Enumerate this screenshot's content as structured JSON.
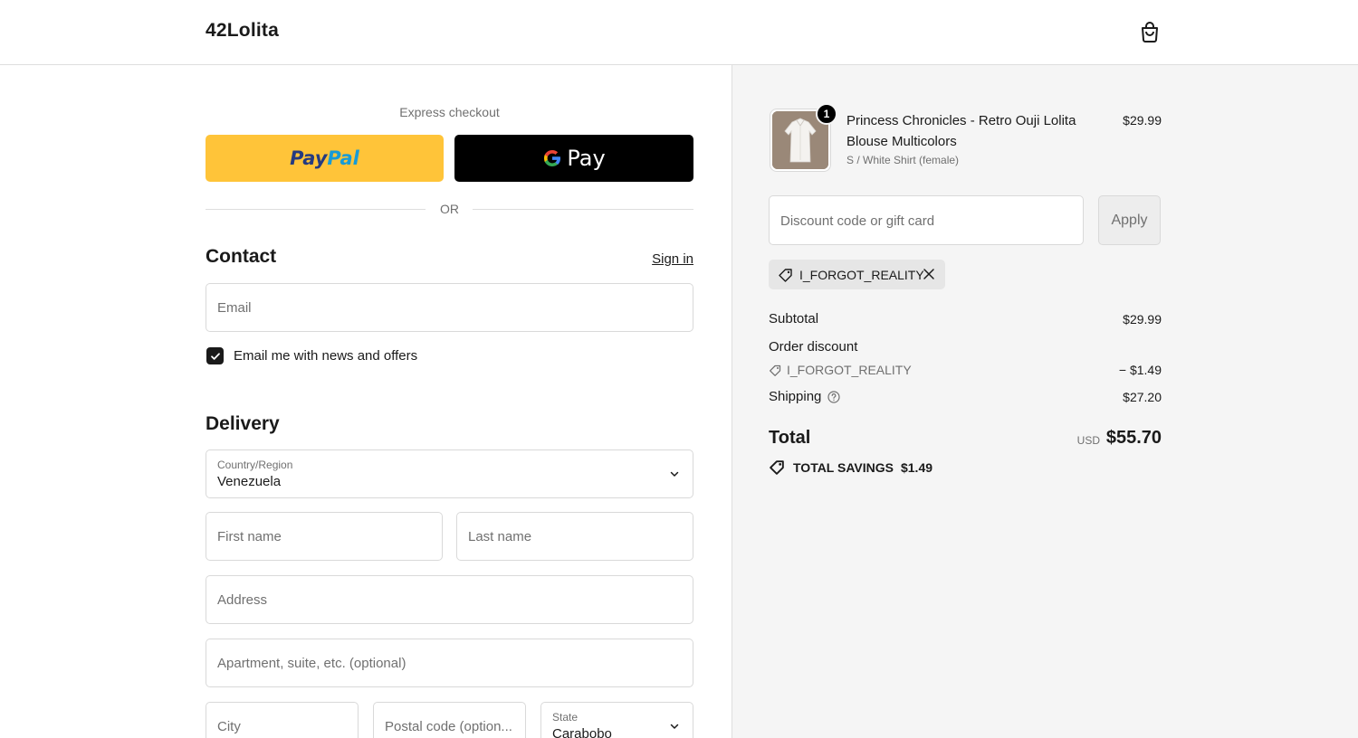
{
  "header": {
    "brand": "42Lolita",
    "icons": {
      "cart": "shopping-bag-icon"
    }
  },
  "express": {
    "label": "Express checkout",
    "paypal_a": "Pay",
    "paypal_b": "Pal",
    "gpay_label": "Pay",
    "or": "OR"
  },
  "contact": {
    "title": "Contact",
    "signin": "Sign in",
    "email_placeholder": "Email",
    "news_label": "Email me with news and offers",
    "news_checked": true
  },
  "delivery": {
    "title": "Delivery",
    "country_label": "Country/Region",
    "country_value": "Venezuela",
    "first_name_placeholder": "First name",
    "last_name_placeholder": "Last name",
    "address_placeholder": "Address",
    "apartment_placeholder": "Apartment, suite, etc. (optional)",
    "city_placeholder": "City",
    "postal_placeholder": "Postal code (option...",
    "state_label": "State",
    "state_value": "Carabobo"
  },
  "summary": {
    "product": {
      "name": "Princess Chronicles - Retro Ouji Lolita Blouse Multicolors",
      "variant": "S / White Shirt (female)",
      "price": "$29.99",
      "quantity": "1"
    },
    "discount_placeholder": "Discount code or gift card",
    "apply_label": "Apply",
    "applied_code": "I_FORGOT_REALITY",
    "subtotal_label": "Subtotal",
    "subtotal_value": "$29.99",
    "order_discount_label": "Order discount",
    "discount_code": "I_FORGOT_REALITY",
    "discount_value": "− $1.49",
    "shipping_label": "Shipping",
    "shipping_value": "$27.20",
    "total_label": "Total",
    "total_currency": "USD",
    "total_value": "$55.70",
    "savings_label": "TOTAL SAVINGS",
    "savings_value": "$1.49"
  },
  "colors": {
    "paypal": "#ffc439",
    "gpay": "#000000",
    "panel": "#f5f5f5"
  }
}
